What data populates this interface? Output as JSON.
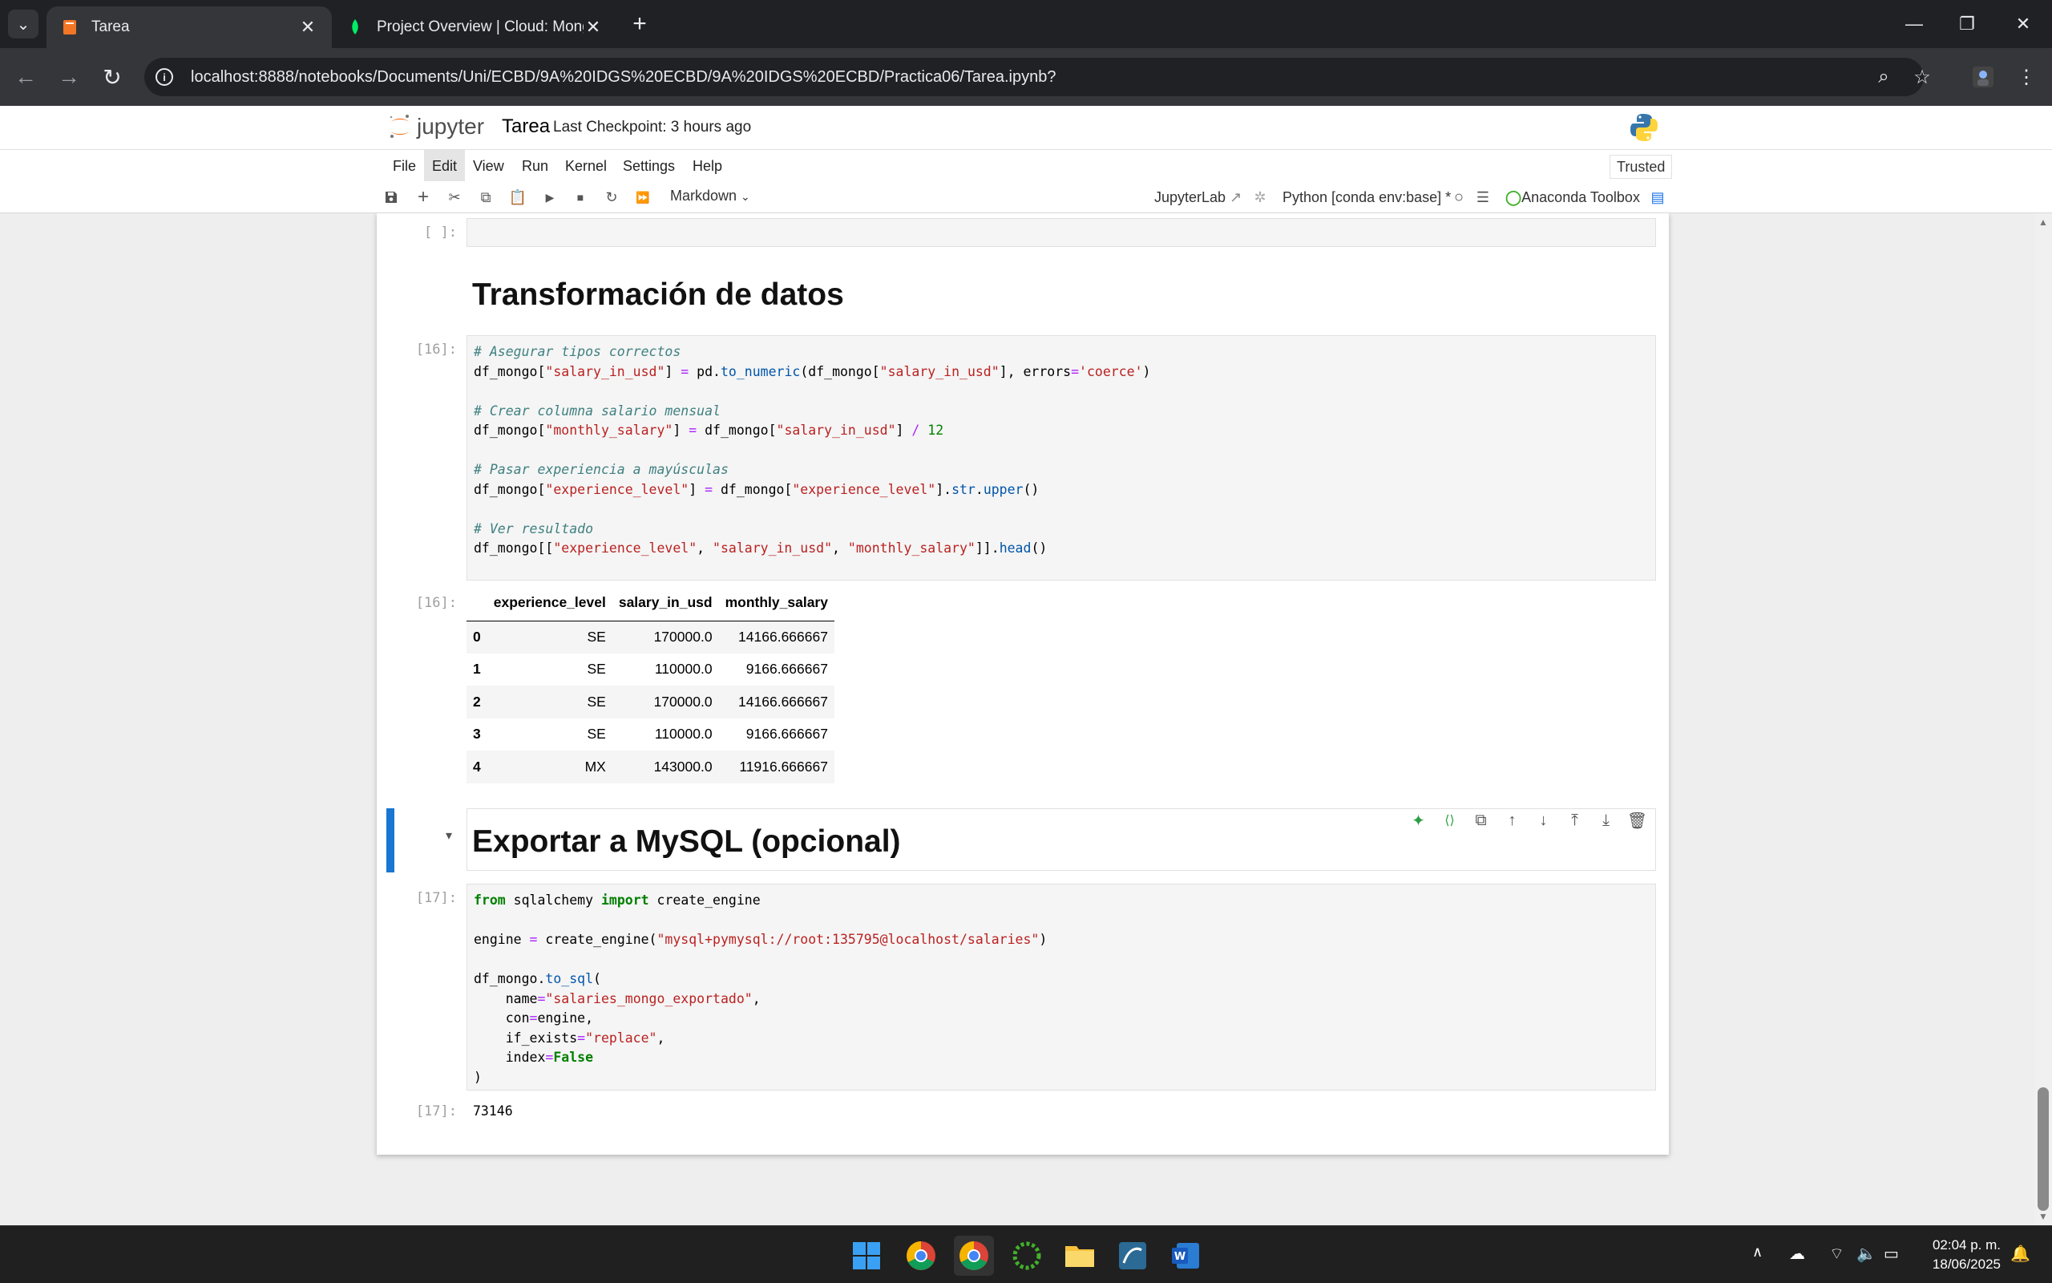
{
  "browser": {
    "tabs": [
      {
        "title": "Tarea",
        "active": true
      },
      {
        "title": "Project Overview | Cloud: Mong",
        "active": false
      }
    ],
    "url": "localhost:8888/notebooks/Documents/Uni/ECBD/9A%20IDGS%20ECBD/9A%20IDGS%20ECBD/Practica06/Tarea.ipynb?"
  },
  "jupyter": {
    "logo_text": "jupyter",
    "notebook_name": "Tarea",
    "checkpoint": "Last Checkpoint: 3 hours ago",
    "menu": [
      "File",
      "Edit",
      "View",
      "Run",
      "Kernel",
      "Settings",
      "Help"
    ],
    "trusted": "Trusted",
    "cell_type": "Markdown",
    "jupyterlab_link": "JupyterLab",
    "kernel": "Python [conda env:base] *",
    "anaconda_toolbox": "Anaconda Toolbox"
  },
  "cells": {
    "empty_prompt": "[ ]:",
    "heading1": "Transformación de datos",
    "code16_prompt": "[16]:",
    "out16_prompt": "[16]:",
    "heading2": "Exportar a MySQL (opcional)",
    "code17_prompt": "[17]:",
    "out17_prompt": "[17]:",
    "out17_value": "73146"
  },
  "dataframe": {
    "columns": [
      "experience_level",
      "salary_in_usd",
      "monthly_salary"
    ],
    "rows": [
      {
        "index": "0",
        "experience_level": "SE",
        "salary_in_usd": "170000.0",
        "monthly_salary": "14166.666667"
      },
      {
        "index": "1",
        "experience_level": "SE",
        "salary_in_usd": "110000.0",
        "monthly_salary": "9166.666667"
      },
      {
        "index": "2",
        "experience_level": "SE",
        "salary_in_usd": "170000.0",
        "monthly_salary": "14166.666667"
      },
      {
        "index": "3",
        "experience_level": "SE",
        "salary_in_usd": "110000.0",
        "monthly_salary": "9166.666667"
      },
      {
        "index": "4",
        "experience_level": "MX",
        "salary_in_usd": "143000.0",
        "monthly_salary": "11916.666667"
      }
    ]
  },
  "taskbar": {
    "time": "02:04 p. m.",
    "date": "18/06/2025"
  }
}
